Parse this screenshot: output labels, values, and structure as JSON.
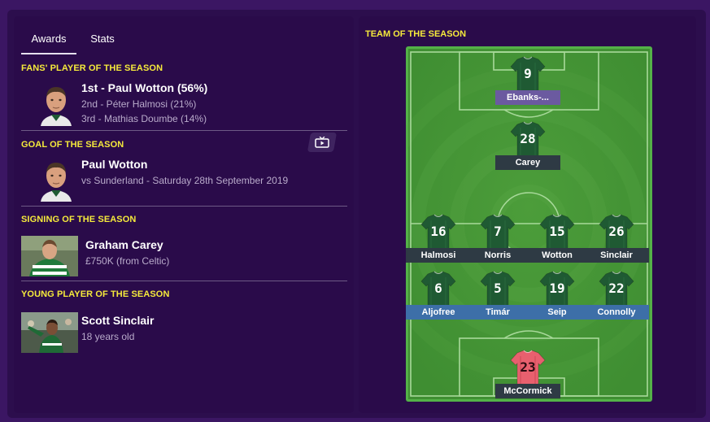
{
  "tabs": [
    {
      "label": "Awards"
    },
    {
      "label": "Stats"
    }
  ],
  "awards": {
    "fans_player": {
      "title": "FANS' PLAYER OF THE SEASON",
      "first": "1st - Paul Wotton (56%)",
      "second": "2nd - Péter Halmosi (21%)",
      "third": "3rd - Mathias Doumbe (14%)"
    },
    "goal": {
      "title": "GOAL OF THE SEASON",
      "name": "Paul Wotton",
      "detail": "vs Sunderland - Saturday 28th September 2019",
      "video_icon": "tv-icon"
    },
    "signing": {
      "title": "SIGNING OF THE SEASON",
      "name": "Graham Carey",
      "detail": "£750K (from Celtic)"
    },
    "young_player": {
      "title": "YOUNG PLAYER OF THE SEASON",
      "name": "Scott Sinclair",
      "detail": "18 years old"
    }
  },
  "team_of_season": {
    "title": "TEAM OF THE SEASON",
    "players": [
      {
        "number": "9",
        "name": "Ebanks-...",
        "label_color": "#6b5aa0",
        "kit": "outfield"
      },
      {
        "number": "28",
        "name": "Carey",
        "label_color": "#2e3a44",
        "kit": "outfield"
      },
      {
        "number": "16",
        "name": "Halmosi",
        "label_color": "#2e3a44",
        "kit": "outfield"
      },
      {
        "number": "7",
        "name": "Norris",
        "label_color": "#2e3a44",
        "kit": "outfield"
      },
      {
        "number": "15",
        "name": "Wotton",
        "label_color": "#2e3a44",
        "kit": "outfield"
      },
      {
        "number": "26",
        "name": "Sinclair",
        "label_color": "#2e3a44",
        "kit": "outfield"
      },
      {
        "number": "6",
        "name": "Aljofree",
        "label_color": "#3d6fa8",
        "kit": "outfield"
      },
      {
        "number": "5",
        "name": "Timár",
        "label_color": "#3d6fa8",
        "kit": "outfield"
      },
      {
        "number": "19",
        "name": "Seip",
        "label_color": "#3d6fa8",
        "kit": "outfield"
      },
      {
        "number": "22",
        "name": "Connolly",
        "label_color": "#3d6fa8",
        "kit": "outfield"
      },
      {
        "number": "23",
        "name": "McCormick",
        "label_color": "#2e3a44",
        "kit": "goalkeeper"
      }
    ]
  },
  "colors": {
    "background": "#3b1663",
    "panel": "#2a0b4a",
    "section_title": "#f5ea3b",
    "pitch_green": "#4a9a3a",
    "pitch_border": "#54b248",
    "outfield_shirt": "#1f5a33",
    "goalkeeper_shirt": "#e8606e"
  }
}
